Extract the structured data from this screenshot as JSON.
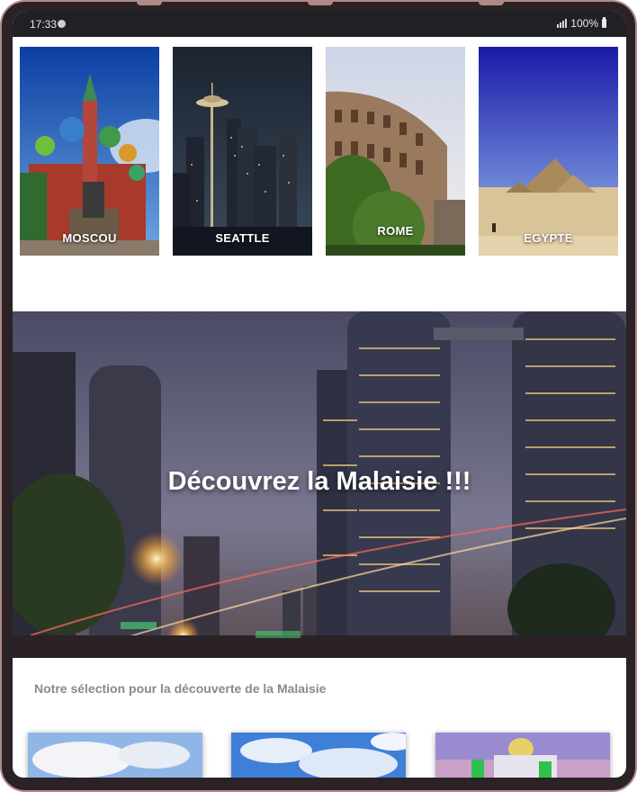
{
  "status_bar": {
    "time": "17:33",
    "battery_text": "100%",
    "icons": [
      "spotify-icon",
      "signal-icon",
      "battery-icon"
    ]
  },
  "destinations": [
    {
      "name": "MOSCOU"
    },
    {
      "name": "SEATTLE"
    },
    {
      "name": "ROME"
    },
    {
      "name": "EGYPTE"
    }
  ],
  "hero": {
    "title": "Découvrez la Malaisie !!!"
  },
  "selection": {
    "title": "Notre sélection pour la découverte de la Malaisie",
    "items": [
      "sky-thumbnail",
      "cloud-thumbnail",
      "mosque-thumbnail"
    ]
  },
  "colors": {
    "status_bar": "#202124",
    "frame": "#b08a86",
    "section_title": "#8a8a8a"
  }
}
